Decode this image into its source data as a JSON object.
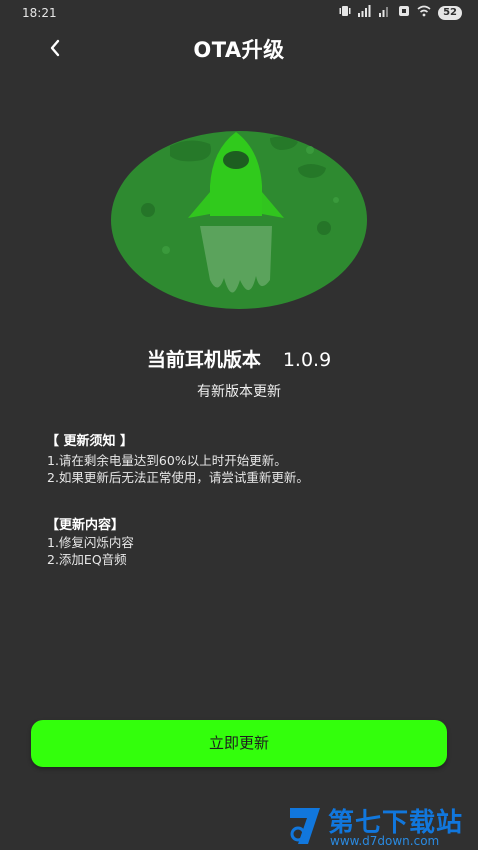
{
  "status_bar": {
    "time": "18:21",
    "battery": "52"
  },
  "header": {
    "title": "OTA升级"
  },
  "version": {
    "label": "当前耳机版本",
    "number": "1.0.9",
    "status": "有新版本更新"
  },
  "notice": {
    "title": "【 更新须知 】",
    "items": [
      "1.请在剩余电量达到60%以上时开始更新。",
      "2.如果更新后无法正常使用，请尝试重新更新。"
    ]
  },
  "changelog": {
    "title": "【更新内容】",
    "items": [
      "1.修复闪烁内容",
      "2.添加EQ音频"
    ]
  },
  "action": {
    "label": "立即更新"
  },
  "watermark": {
    "name": "第七下载站",
    "url": "www.d7down.com"
  },
  "colors": {
    "background": "#303030",
    "accent": "#33ff0c",
    "planet": "#2e8a30"
  }
}
